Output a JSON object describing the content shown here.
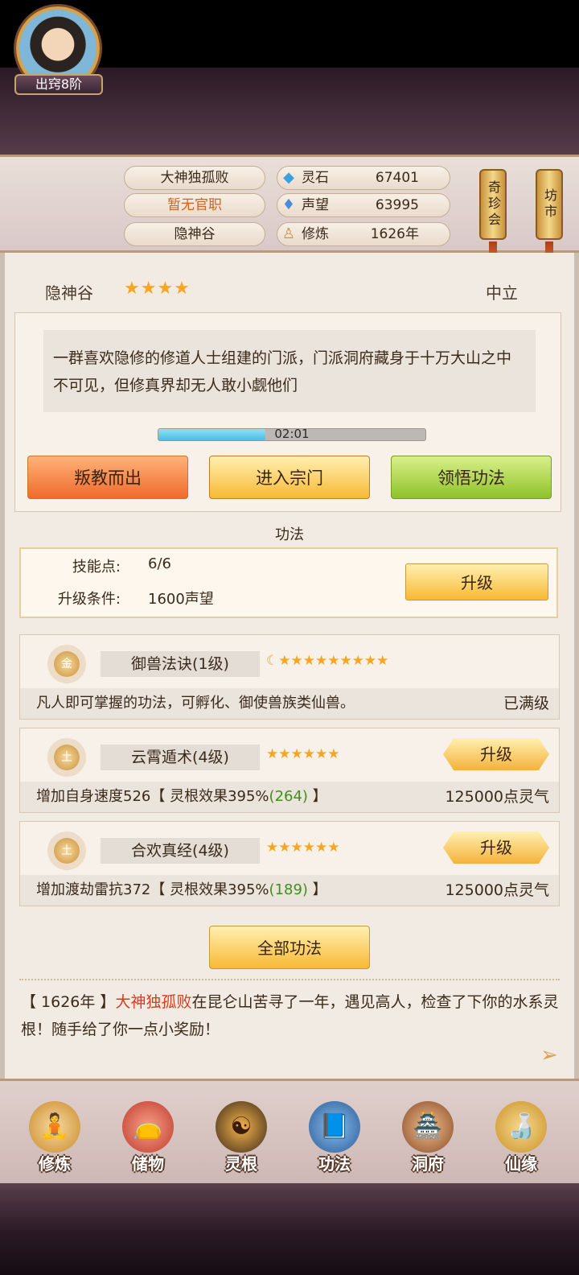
{
  "player": {
    "name": "大神独孤败",
    "official_post": "暂无官职",
    "sect": "隐神谷",
    "rank": "出窍8阶"
  },
  "resources": [
    {
      "icon": "spirit-stone-icon",
      "label": "灵石",
      "value": "67401"
    },
    {
      "icon": "prestige-icon",
      "label": "声望",
      "value": "63995"
    },
    {
      "icon": "cultivation-icon",
      "label": "修炼",
      "value": "1626年"
    }
  ],
  "side_buttons": {
    "treasure_fair": "奇珍会",
    "market": "坊市"
  },
  "sect_info": {
    "name": "隐神谷",
    "stars": "★★★★",
    "alignment": "中立",
    "description": "一群喜欢隐修的修道人士组建的门派，门派洞府藏身于十万大山之中不可见，但修真界却无人敢小觑他们",
    "timer": "02:01",
    "timer_progress": 0.4
  },
  "actions": {
    "betray": "叛教而出",
    "enter": "进入宗门",
    "comprehend": "领悟功法"
  },
  "gongfa_section": {
    "title": "功法",
    "skill_points_label": "技能点:",
    "skill_points_value": "6/6",
    "upgrade_cond_label": "升级条件:",
    "upgrade_cond_value": "1600声望",
    "upgrade_button": "升级"
  },
  "skills": [
    {
      "element": "金",
      "name": "御兽法诀(1级)",
      "stars": "☾★★★★★★★★★",
      "effect_prefix": "凡人即可掌握的功法，可孵化、御使兽族类仙兽。",
      "effect_green": "",
      "effect_suffix": "",
      "status": "已满级",
      "button": ""
    },
    {
      "element": "土",
      "name": "云霄遁术(4级)",
      "stars": "★★★★★★",
      "effect_prefix": "增加自身速度526【 灵根效果395%",
      "effect_green": "(264)",
      "effect_suffix": " 】",
      "status": "125000点灵气",
      "button": "升级"
    },
    {
      "element": "土",
      "name": "合欢真经(4级)",
      "stars": "★★★★★★",
      "effect_prefix": "增加渡劫雷抗372【 灵根效果395%",
      "effect_green": "(189)",
      "effect_suffix": " 】",
      "status": "125000点灵气",
      "button": "升级"
    }
  ],
  "all_gongfa_button": "全部功法",
  "log": {
    "year": "【 1626年 】",
    "who": "大神独孤败",
    "text": "在昆仑山苦寻了一年，遇见高人，检查了下你的水系灵根！随手给了你一点小奖励！"
  },
  "nav": [
    {
      "label": "修炼",
      "icon": "cultivate-icon",
      "glyph": "🧘"
    },
    {
      "label": "储物",
      "icon": "storage-bag-icon",
      "glyph": "👝"
    },
    {
      "label": "灵根",
      "icon": "spirit-root-icon",
      "glyph": "☯"
    },
    {
      "label": "功法",
      "icon": "book-icon",
      "glyph": "📘"
    },
    {
      "label": "洞府",
      "icon": "cave-house-icon",
      "glyph": "🏯"
    },
    {
      "label": "仙缘",
      "icon": "gourd-icon",
      "glyph": "🍶"
    }
  ],
  "colors": {
    "accent_red": "#d83a1a",
    "green": "#3f8f1a",
    "star": "#f5a623"
  }
}
